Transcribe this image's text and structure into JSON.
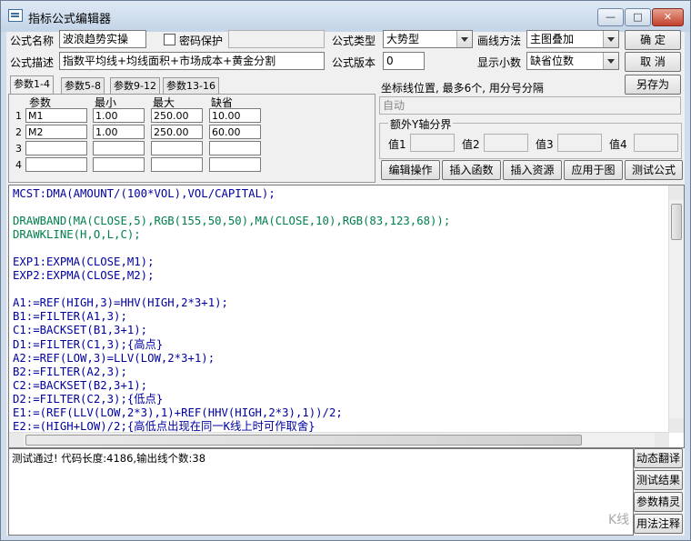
{
  "window": {
    "title": "指标公式编辑器",
    "minimize_label": "—",
    "maximize_label": "□",
    "close_label": "✕"
  },
  "form": {
    "name_label": "公式名称",
    "name_value": "波浪趋势实操",
    "password_label": "密码保护",
    "password_value": "",
    "type_label": "公式类型",
    "type_value": "大势型",
    "draw_label": "画线方法",
    "draw_value": "主图叠加",
    "desc_label": "公式描述",
    "desc_value": "指数平均线+均线面积+市场成本+黄金分割",
    "version_label": "公式版本",
    "version_value": "0",
    "decimals_label": "显示小数",
    "decimals_value": "缺省位数"
  },
  "buttons": {
    "ok": "确  定",
    "cancel": "取  消",
    "save_as": "另存为",
    "edit_ops": "编辑操作",
    "insert_func": "插入函数",
    "insert_res": "插入资源",
    "apply_chart": "应用于图",
    "test_formula": "测试公式",
    "dyn_translate": "动态翻译",
    "test_result": "测试结果",
    "param_wizard": "参数精灵",
    "usage_notes": "用法注释"
  },
  "param_tabs": [
    "参数1-4",
    "参数5-8",
    "参数9-12",
    "参数13-16"
  ],
  "params": {
    "headers": [
      "参数",
      "最小",
      "最大",
      "缺省"
    ],
    "rows": [
      {
        "no": "1",
        "name": "M1",
        "min": "1.00",
        "max": "250.00",
        "default": "10.00"
      },
      {
        "no": "2",
        "name": "M2",
        "min": "1.00",
        "max": "250.00",
        "default": "60.00"
      },
      {
        "no": "3",
        "name": "",
        "min": "",
        "max": "",
        "default": ""
      },
      {
        "no": "4",
        "name": "",
        "min": "",
        "max": "",
        "default": ""
      }
    ]
  },
  "axis": {
    "label": "坐标线位置, 最多6个, 用分号分隔",
    "value": "自动",
    "extra_group": "额外Y轴分界",
    "v1_label": "值1",
    "v2_label": "值2",
    "v3_label": "值3",
    "v4_label": "值4"
  },
  "code_lines": [
    "MCST:DMA(AMOUNT/(100*VOL),VOL/CAPITAL);",
    "",
    "DRAWBAND(MA(CLOSE,5),RGB(155,50,50),MA(CLOSE,10),RGB(83,123,68));",
    "DRAWKLINE(H,O,L,C);",
    "",
    "EXP1:EXPMA(CLOSE,M1);",
    "EXP2:EXPMA(CLOSE,M2);",
    "",
    "A1:=REF(HIGH,3)=HHV(HIGH,2*3+1);",
    "B1:=FILTER(A1,3);",
    "C1:=BACKSET(B1,3+1);",
    "D1:=FILTER(C1,3);{高点}",
    "A2:=REF(LOW,3)=LLV(LOW,2*3+1);",
    "B2:=FILTER(A2,3);",
    "C2:=BACKSET(B2,3+1);",
    "D2:=FILTER(C2,3);{低点}",
    "E1:=(REF(LLV(LOW,2*3),1)+REF(HHV(HIGH,2*3),1))/2;",
    "E2:=(HIGH+LOW)/2;{高低点出现在同一K线上时可作取舍}"
  ],
  "status": {
    "message": "测试通过! 代码长度:4186,输出线个数:38"
  },
  "watermark": "K线"
}
